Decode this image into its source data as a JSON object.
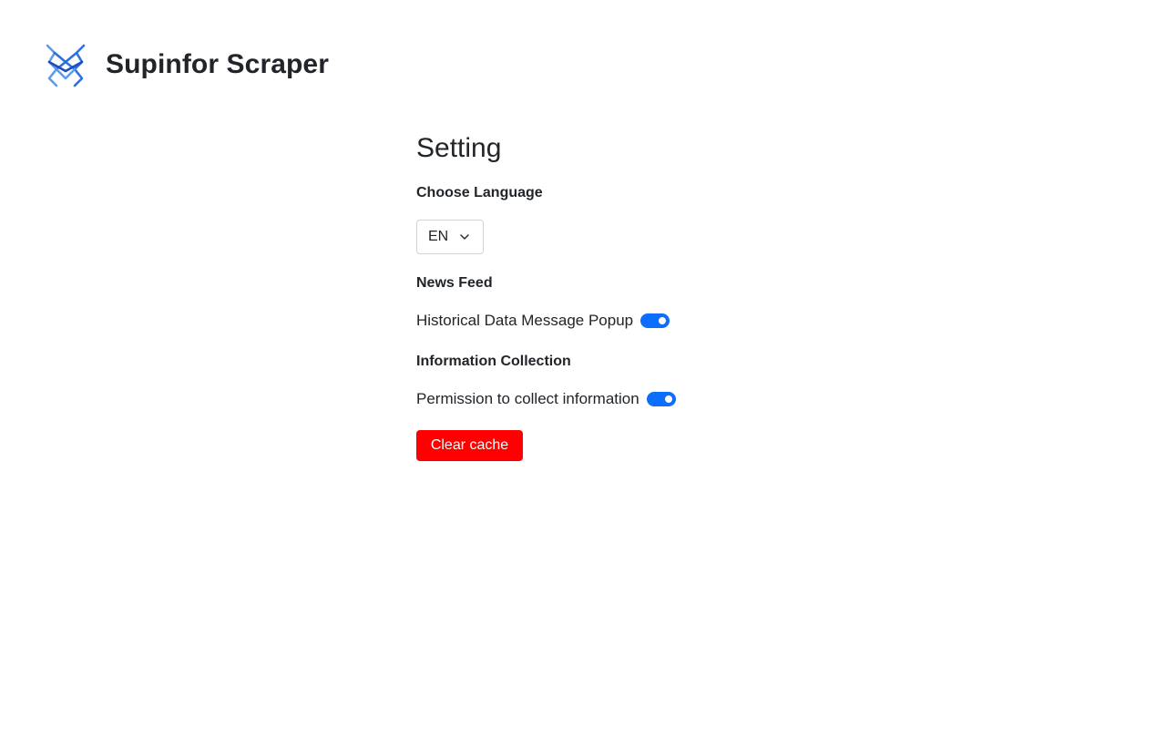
{
  "header": {
    "logo_icon": "spider-icon",
    "app_title": "Supinfor Scraper"
  },
  "settings": {
    "title": "Setting",
    "language": {
      "label": "Choose Language",
      "selected": "EN",
      "icon": "chevron-down-icon"
    },
    "news_feed": {
      "label": "News Feed",
      "toggle_label": "Historical Data Message Popup",
      "enabled": true
    },
    "information_collection": {
      "label": "Information Collection",
      "toggle_label": "Permission to collect information",
      "enabled": true
    },
    "clear_cache_label": "Clear cache"
  },
  "colors": {
    "accent": "#0d6efd",
    "danger": "#ff0000",
    "logo_blue": "#2f6fdf",
    "text": "#212529"
  }
}
